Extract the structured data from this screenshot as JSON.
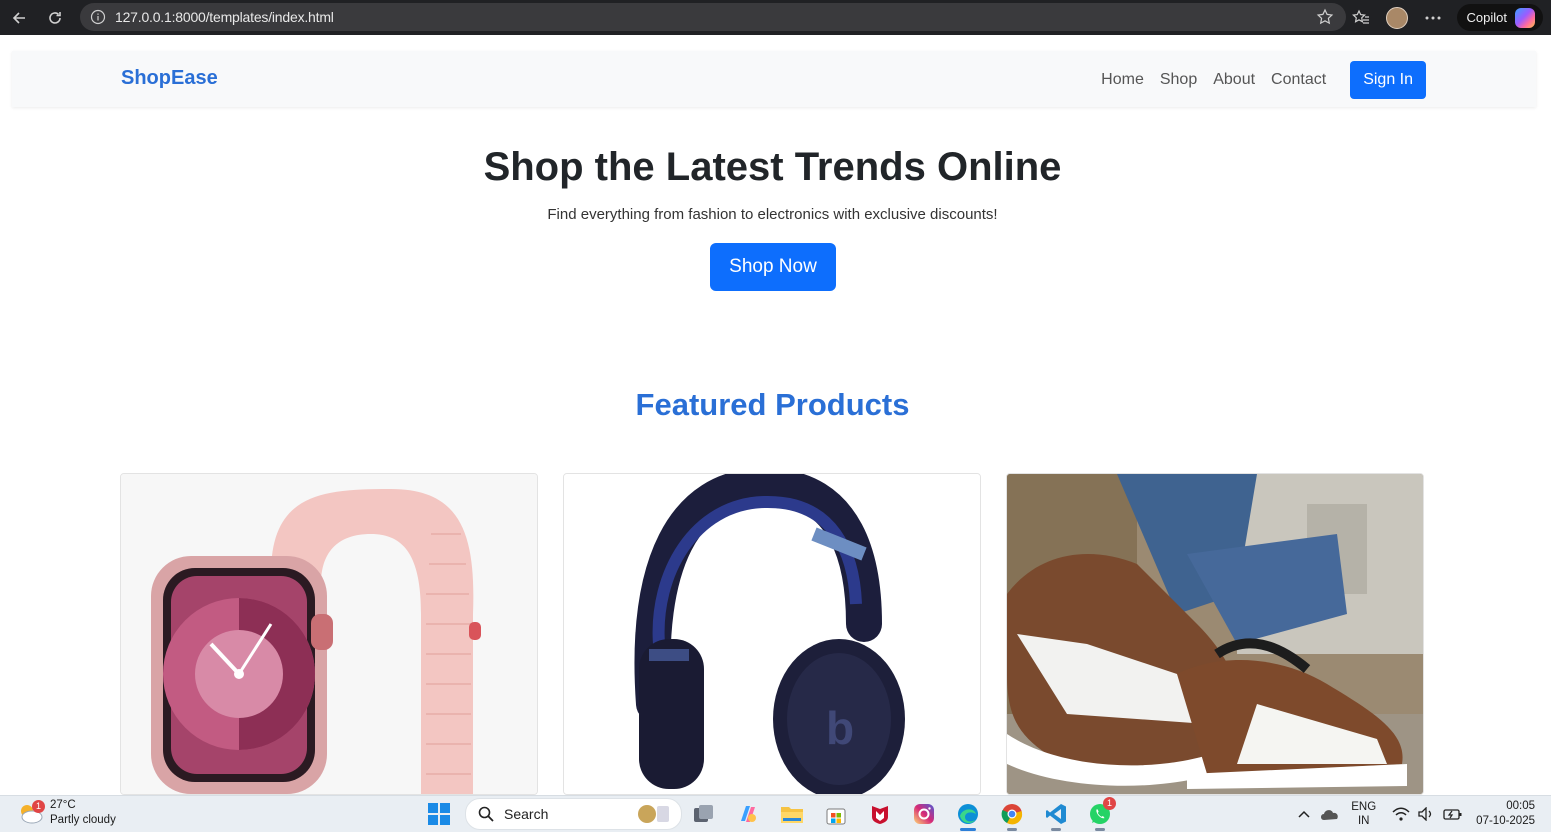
{
  "browser": {
    "url": "127.0.0.1:8000/templates/index.html",
    "copilot_label": "Copilot"
  },
  "navbar": {
    "brand": "ShopEase",
    "links": [
      "Home",
      "Shop",
      "About",
      "Contact"
    ],
    "signin_label": "Sign In"
  },
  "hero": {
    "title": "Shop the Latest Trends Online",
    "subtitle": "Find everything from fashion to electronics with exclusive discounts!",
    "cta_label": "Shop Now"
  },
  "featured": {
    "heading": "Featured Products",
    "products": [
      {
        "image": "pink-smartwatch-image"
      },
      {
        "image": "navy-headphones-image"
      },
      {
        "image": "sneakers-image"
      }
    ]
  },
  "taskbar": {
    "weather_temp": "27°C",
    "weather_desc": "Partly cloudy",
    "weather_badge": "1",
    "search_label": "Search",
    "lang_top": "ENG",
    "lang_bottom": "IN",
    "time": "00:05",
    "date": "07-10-2025",
    "whatsapp_badge": "1"
  },
  "colors": {
    "primary": "#0d6efd",
    "brand": "#2a6fd6",
    "chrome": "#202124"
  }
}
